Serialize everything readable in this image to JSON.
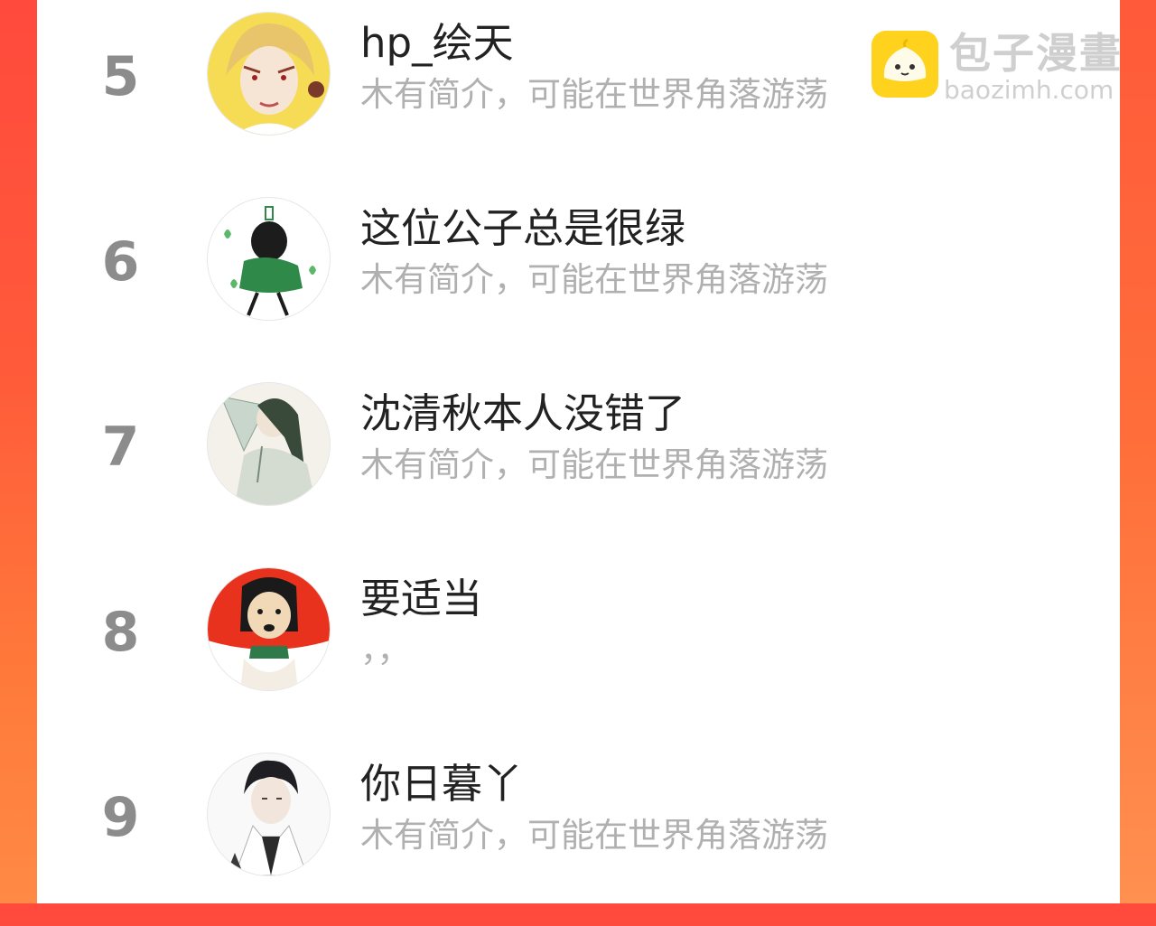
{
  "watermark": {
    "title": "包子漫畫",
    "url": "baozimh.com",
    "logo_icon": "bun-logo-icon",
    "logo_color": "#ffd21e"
  },
  "colors": {
    "background_accent": "#ff4a3d",
    "rank": "#8c8c8c",
    "name": "#222222",
    "bio": "#b0b0b0"
  },
  "list": {
    "rows": [
      {
        "rank": "5",
        "name": "hp_绘天",
        "bio": "木有简介，可能在世界角落游荡",
        "avatar_icon": "anime-portrait-blond-avatar"
      },
      {
        "rank": "6",
        "name": "这位公子总是很绿",
        "bio": "木有简介，可能在世界角落游荡",
        "avatar_icon": "green-cloak-figure-avatar"
      },
      {
        "rank": "7",
        "name": "沈清秋本人没错了",
        "bio": "木有简介，可能在世界角落游荡",
        "avatar_icon": "fan-holding-figure-avatar"
      },
      {
        "rank": "8",
        "name": "要适当",
        "bio": "，，",
        "avatar_icon": "red-sun-woman-avatar"
      },
      {
        "rank": "9",
        "name": "你日暮丫",
        "bio": "木有简介，可能在世界角落游荡",
        "avatar_icon": "dark-hair-boy-avatar"
      }
    ]
  }
}
